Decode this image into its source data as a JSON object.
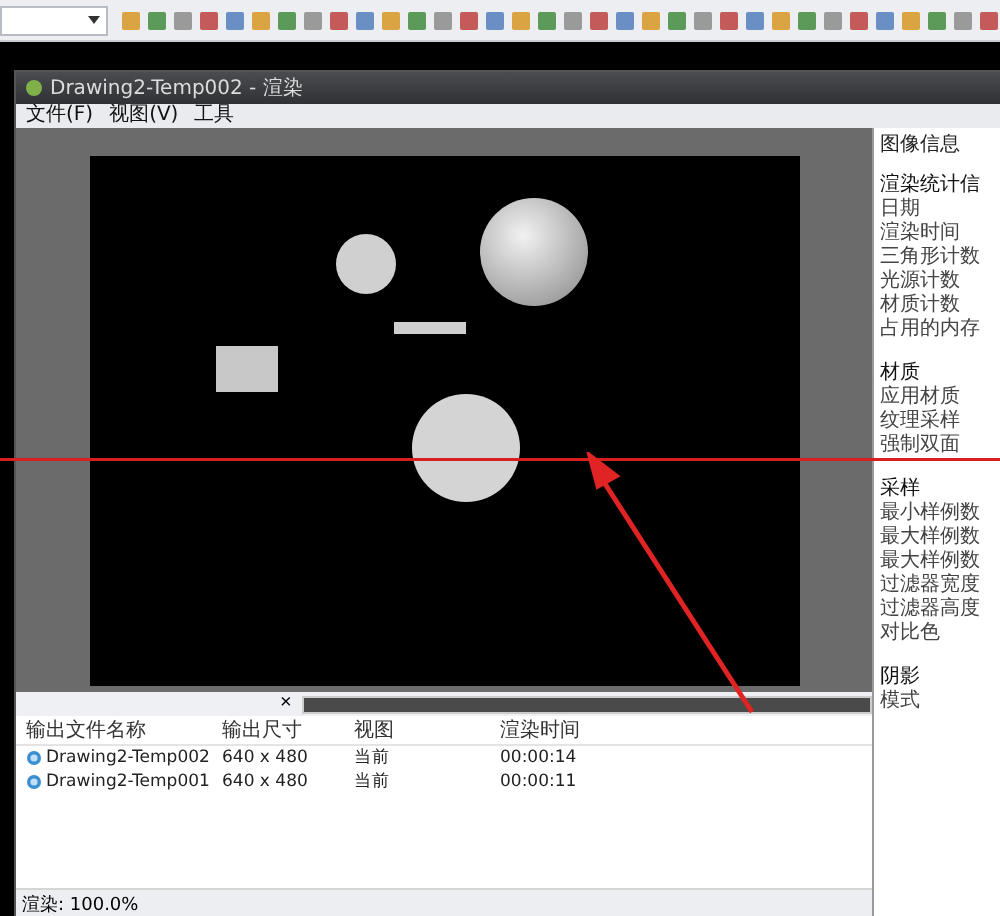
{
  "window": {
    "title": "Drawing2-Temp002 - 渲染"
  },
  "menu": [
    "文件(F)",
    "视图(V)",
    "工具"
  ],
  "info_panel": {
    "title": "图像信息",
    "sections": [
      {
        "heading": "渲染统计信",
        "items": [
          "日期",
          "渲染时间",
          "三角形计数",
          "光源计数",
          "材质计数",
          "占用的内存"
        ]
      },
      {
        "heading": "材质",
        "items": [
          "应用材质",
          "纹理采样",
          "强制双面"
        ]
      },
      {
        "heading": "采样",
        "items": [
          "最小样例数",
          "最大样例数",
          "最大样例数",
          "过滤器宽度",
          "过滤器高度",
          "对比色"
        ]
      },
      {
        "heading": "阴影",
        "items": [
          "模式"
        ]
      }
    ]
  },
  "output_list": {
    "close": "×",
    "progress": {
      "level": 1
    },
    "columns": [
      "输出文件名称",
      "输出尺寸",
      "视图",
      "渲染时间"
    ],
    "rows": [
      {
        "name": "Drawing2-Temp002",
        "size": "640 x 480",
        "view": "当前",
        "time": "00:00:14"
      },
      {
        "name": "Drawing2-Temp001",
        "size": "640 x 480",
        "view": "当前",
        "time": "00:00:11"
      }
    ]
  },
  "status_bar": "渲染: 100.0%"
}
